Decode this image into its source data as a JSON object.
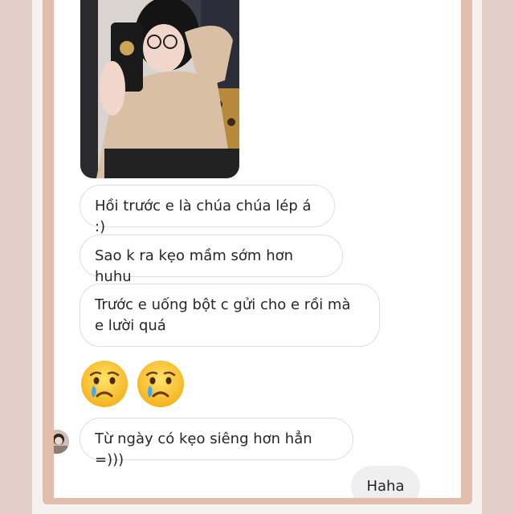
{
  "conversation": {
    "received_messages": [
      "Hồi trước e là chúa chúa lép á :)",
      "Sao k ra kẹo mầm sớm hơn huhu",
      "Trước e uống bột c gửi cho e rồi mà e lười quá",
      "Từ ngày có kẹo siêng hơn hẳn =)))"
    ],
    "emoji_message": [
      "crying-face",
      "crying-face"
    ],
    "sent_message": "Haha"
  },
  "icons": {
    "photo": "selfie-photo",
    "avatar": "sender-avatar"
  },
  "colors": {
    "frame": "#e2bdab",
    "background_strips": "#e4cfc8",
    "bubble_border": "#dedede",
    "sent_bubble": "#efefef",
    "text": "#262626"
  }
}
